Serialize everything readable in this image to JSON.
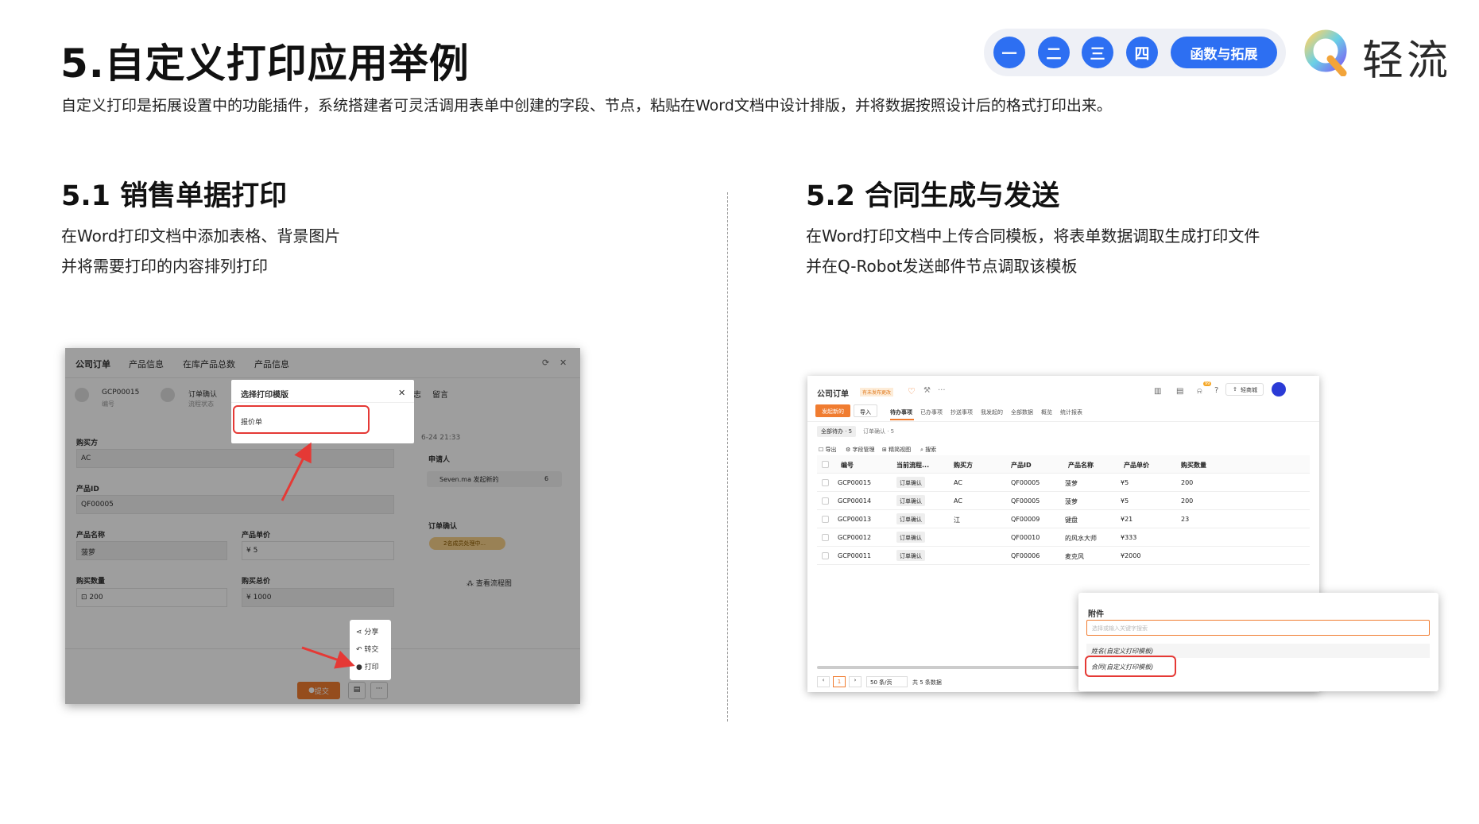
{
  "header": {
    "title": "5.自定义打印应用举例",
    "subtitle": "自定义打印是拓展设置中的功能插件，系统搭建者可灵活调用表单中创建的字段、节点，粘贴在Word文档中设计排版，并将数据按照设计后的格式打印出来。",
    "nav": [
      "一",
      "二",
      "三",
      "四"
    ],
    "nav_pill": "函数与拓展",
    "logo_text": "轻流"
  },
  "left": {
    "heading": "5.1 销售单据打印",
    "desc1": "在Word打印文档中添加表格、背景图片",
    "desc2": "并将需要打印的内容排列打印",
    "shot": {
      "tabs": [
        "公司订单",
        "产品信息",
        "在库产品总数",
        "产品信息"
      ],
      "id_value": "GCP00015",
      "id_label": "编号",
      "status_value": "订单确认",
      "status_label": "流程状态",
      "tab_log": "志",
      "tab_msg": "留言",
      "date": "6-24 21:33",
      "fields": {
        "buyer_label": "购买方",
        "buyer": "AC",
        "pid_label": "产品ID",
        "pid": "QF00005",
        "pname_label": "产品名称",
        "pname": "菠萝",
        "price_label": "产品单价",
        "price": "¥ 5",
        "qty_label": "购买数量",
        "qty": "200",
        "total_label": "购买总价",
        "total": "¥ 1000"
      },
      "applicant_label": "申请人",
      "applicant_event": "Seven.ma 发起新的",
      "applicant_count": "6",
      "confirm_label": "订单确认",
      "confirm_status": "2名成员处理中...",
      "flowchart": "查看流程图",
      "modal_title": "选择打印模版",
      "modal_option": "报价单",
      "menu": [
        "分享",
        "转交",
        "打印"
      ],
      "submit": "提交"
    }
  },
  "right": {
    "heading": "5.2 合同生成与发送",
    "desc1": "在Word打印文档中上传合同模板，将表单数据调取生成打印文件",
    "desc2": "并在Q-Robot发送邮件节点调取该模板",
    "shot": {
      "title": "公司订单",
      "tag": "有未发布更改",
      "mall": "轻商城",
      "notif_count": "99",
      "new_btn": "发起新的",
      "import_btn": "导入",
      "tabs": [
        "待办事项",
        "已办事项",
        "抄送事项",
        "我发起的",
        "全部数据",
        "概览",
        "统计报表"
      ],
      "filters": [
        "全部待办 · 5",
        "订单确认 · 5"
      ],
      "tools": [
        "导出",
        "字段管理",
        "精简视图",
        "搜索"
      ],
      "columns": [
        "编号",
        "当前流程...",
        "购买方",
        "产品ID",
        "产品名称",
        "产品单价",
        "购买数量"
      ],
      "rows": [
        [
          "GCP00015",
          "订单确认",
          "AC",
          "QF00005",
          "菠萝",
          "¥5",
          "200"
        ],
        [
          "GCP00014",
          "订单确认",
          "AC",
          "QF00005",
          "菠萝",
          "¥5",
          "200"
        ],
        [
          "GCP00013",
          "订单确认",
          "江",
          "QF00009",
          "键盘",
          "¥21",
          "23"
        ],
        [
          "GCP00012",
          "订单确认",
          "",
          "QF00010",
          "的风水大师",
          "¥333",
          ""
        ],
        [
          "GCP00011",
          "订单确认",
          "",
          "QF00006",
          "麦克风",
          "¥2000",
          ""
        ]
      ],
      "page_num": "1",
      "page_size": "50 条/页",
      "total": "共 5 条数据",
      "attach_title": "附件",
      "attach_placeholder": "选择或输入关键字搜索",
      "attach_options": [
        "姓名(自定义打印模板)",
        "合同(自定义打印模板)"
      ]
    }
  },
  "colors": {
    "accent": "#2d6ff2",
    "highlight": "#e53935",
    "orange": "#f07c30"
  }
}
